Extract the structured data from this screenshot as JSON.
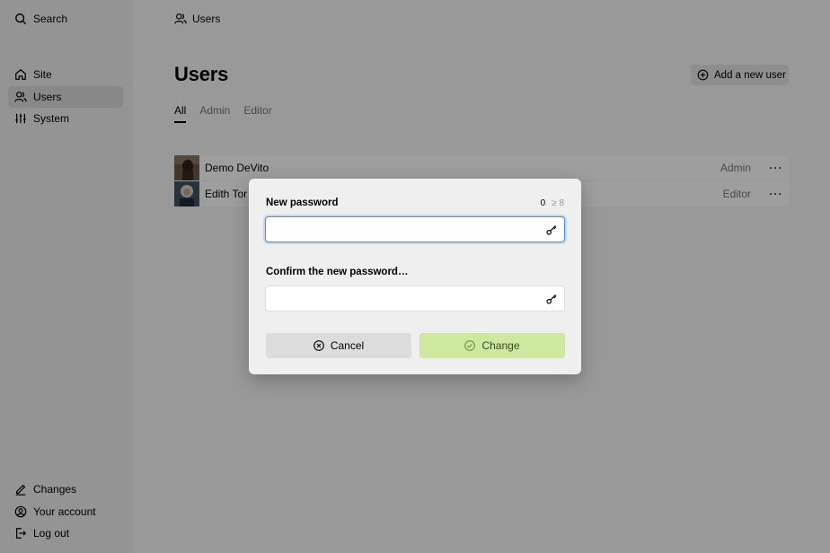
{
  "sidebar": {
    "search_label": "Search",
    "nav": [
      {
        "label": "Site",
        "icon": "home-icon"
      },
      {
        "label": "Users",
        "icon": "users-icon",
        "active": true
      },
      {
        "label": "System",
        "icon": "sliders-icon"
      }
    ],
    "bottom": [
      {
        "label": "Changes",
        "icon": "edit-icon"
      },
      {
        "label": "Your account",
        "icon": "account-icon"
      },
      {
        "label": "Log out",
        "icon": "logout-icon"
      }
    ]
  },
  "header": {
    "breadcrumb": "Users",
    "title": "Users",
    "add_button": "Add a new user"
  },
  "tabs": [
    {
      "label": "All",
      "active": true
    },
    {
      "label": "Admin"
    },
    {
      "label": "Editor"
    }
  ],
  "users": [
    {
      "name": "Demo DeVito",
      "role": "Admin",
      "options": "···"
    },
    {
      "name": "Edith Tor",
      "role": "Editor",
      "options": "···"
    }
  ],
  "dialog": {
    "new_password_label": "New password",
    "counter_current": "0",
    "counter_min": "≥ 8",
    "new_password_value": "",
    "confirm_label": "Confirm the new password…",
    "confirm_value": "",
    "cancel_label": "Cancel",
    "change_label": "Change"
  },
  "colors": {
    "accent": "#4a90e2",
    "change_button": "#cde89f",
    "cancel_button": "#dcdcdc",
    "overlay": "rgba(0,0,0,0.38)"
  }
}
